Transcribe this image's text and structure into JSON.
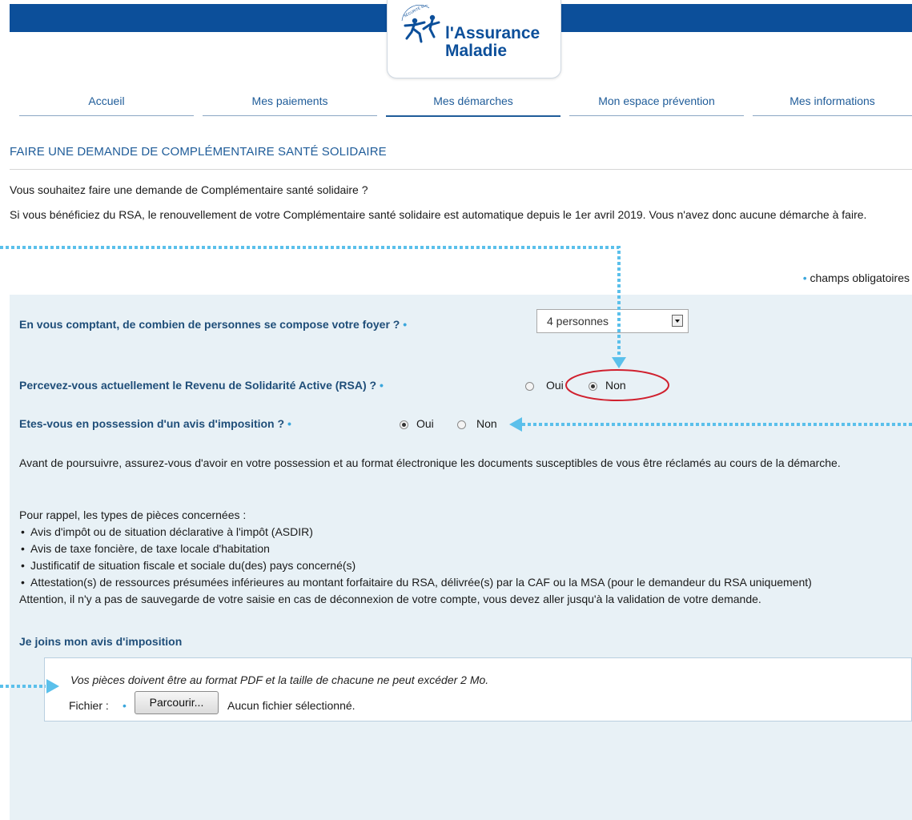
{
  "brand": {
    "name_line1": "l'Assurance",
    "name_line2": "Maladie",
    "emblem_text": "SÉCURITÉ SOCIALE"
  },
  "nav": {
    "items": [
      {
        "label": "Accueil"
      },
      {
        "label": "Mes paiements"
      },
      {
        "label": "Mes démarches"
      },
      {
        "label": "Mon espace prévention"
      },
      {
        "label": "Mes informations"
      }
    ],
    "active_index": 2
  },
  "page": {
    "title": "FAIRE UNE DEMANDE DE COMPLÉMENTAIRE SANTÉ SOLIDAIRE",
    "intro_question": "Vous souhaitez faire une demande de Complémentaire santé solidaire ?",
    "intro_rsa": "Si vous bénéficiez du RSA, le renouvellement de votre Complémentaire santé solidaire est automatique depuis le 1er avril 2019. Vous n'avez donc aucune démarche à faire.",
    "required_marker": "•",
    "required_note": "champs obligatoires"
  },
  "form": {
    "household": {
      "question": "En vous comptant, de combien de personnes se compose votre foyer ?",
      "required_marker": "•",
      "selected": "4 personnes"
    },
    "rsa": {
      "question": "Percevez-vous actuellement le Revenu de Solidarité Active (RSA) ?",
      "required_marker": "•",
      "options": [
        "Oui",
        "Non"
      ],
      "selected": "Non"
    },
    "tax_notice": {
      "question": "Etes-vous en possession d'un avis d'imposition ?",
      "required_marker": "•",
      "options": [
        "Oui",
        "Non"
      ],
      "selected": "Oui"
    },
    "before_continue": "Avant de poursuivre, assurez-vous d'avoir en votre possession et au format électronique les documents susceptibles de vous être réclamés au cours de la démarche.",
    "reminder_intro": "Pour rappel, les types de pièces concernées :",
    "documents": [
      "Avis d'impôt ou de situation déclarative à l'impôt (ASDIR)",
      "Avis de taxe foncière, de taxe locale d'habitation",
      "Justificatif de situation fiscale et sociale du(des) pays concerné(s)",
      "Attestation(s) de ressources présumées inférieures au montant forfaitaire du RSA, délivrée(s) par la CAF ou la MSA (pour le demandeur du RSA uniquement)"
    ],
    "warning": "Attention, il n'y a pas de sauvegarde de votre saisie en cas de déconnexion de votre compte, vous devez aller jusqu'à la validation de votre demande.",
    "upload": {
      "title": "Je joins mon avis d'imposition",
      "note": "Vos pièces doivent être au format PDF et la taille de chacune ne peut excéder 2 Mo.",
      "file_label": "Fichier :",
      "required_marker": "•",
      "button_label": "Parcourir...",
      "status": "Aucun fichier sélectionné."
    }
  },
  "colors": {
    "header_bar": "#0c4f9a",
    "link_blue": "#1f5c99",
    "question_blue": "#1f4e79",
    "panel_bg": "#e8f1f6",
    "annotation_blue": "#5bc0eb",
    "highlight_red": "#d0202e"
  }
}
